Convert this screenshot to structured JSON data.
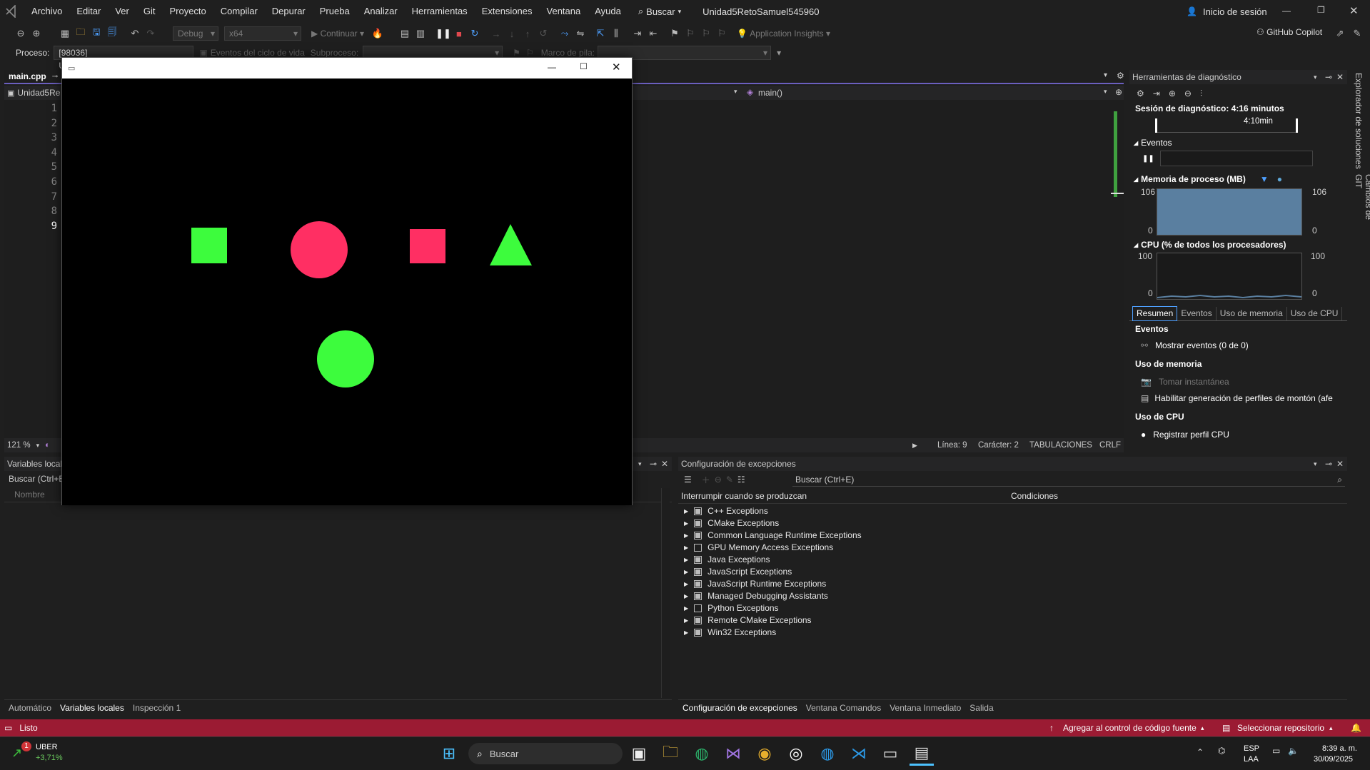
{
  "menubar": {
    "items": [
      "Archivo",
      "Editar",
      "Ver",
      "Git",
      "Proyecto",
      "Compilar",
      "Depurar",
      "Prueba",
      "Analizar",
      "Herramientas",
      "Extensiones",
      "Ventana",
      "Ayuda"
    ],
    "search": "Buscar",
    "solution": "Unidad5RetoSamuel545960",
    "signin": "Inicio de sesión"
  },
  "toolbar": {
    "config": "Debug",
    "platform": "x64",
    "continue": "Continuar",
    "app_insights": "Application Insights",
    "copilot": "GitHub Copilot"
  },
  "procbar": {
    "label": "Proceso:",
    "process": "[98036] Unidad5RetoSamuel54596(",
    "lifecycle": "Eventos del ciclo de vida",
    "thread_label": "Subproceso:",
    "stack_label": "Marco de pila:"
  },
  "editor": {
    "tab": "main.cpp",
    "project": "Unidad5Re",
    "function": "main()",
    "lines": [
      "1",
      "2",
      "3",
      "4",
      "5",
      "6",
      "7",
      "8",
      "9"
    ],
    "zoom": "121 %",
    "line": "Línea: 9",
    "col": "Carácter: 2",
    "tabs_mode": "TABULACIONES",
    "eol": "CRLF"
  },
  "app_window": {
    "shapes": [
      {
        "type": "square",
        "color": "#3dfc3d"
      },
      {
        "type": "circle",
        "color": "#ff2f63"
      },
      {
        "type": "square",
        "color": "#ff2f63"
      },
      {
        "type": "triangle",
        "color": "#3dfc3d"
      },
      {
        "type": "circle",
        "color": "#3dfc3d"
      }
    ]
  },
  "diag": {
    "title": "Herramientas de diagnóstico",
    "session": "Sesión de diagnóstico: 4:16 minutos",
    "timeline_label": "4:10min",
    "events": "Eventos",
    "memory": "Memoria de proceso (MB)",
    "mem_max": "106",
    "mem_min": "0",
    "cpu": "CPU (% de todos los procesadores)",
    "cpu_max": "100",
    "cpu_min": "0",
    "tabs": [
      "Resumen",
      "Eventos",
      "Uso de memoria",
      "Uso de CPU"
    ],
    "sum_events": "Eventos",
    "show_events": "Mostrar eventos (0 de 0)",
    "mem_use": "Uso de memoria",
    "snapshot": "Tomar instantánea",
    "heap": "Habilitar generación de perfiles de montón (afe",
    "cpu_use": "Uso de CPU",
    "cpu_profile": "Registrar perfil CPU"
  },
  "vtabs": [
    "Explorador de soluciones",
    "Cambios de GIT"
  ],
  "locals": {
    "title": "Variables locales",
    "search": "Buscar (Ctrl+E)",
    "col_name": "Nombre",
    "tabs": [
      "Automático",
      "Variables locales",
      "Inspección 1"
    ]
  },
  "exceptions": {
    "title": "Configuración de excepciones",
    "search": "Buscar (Ctrl+E)",
    "col_break": "Interrumpir cuando se produzcan",
    "col_cond": "Condiciones",
    "items": [
      {
        "label": "C++ Exceptions",
        "on": true
      },
      {
        "label": "CMake Exceptions",
        "on": true
      },
      {
        "label": "Common Language Runtime Exceptions",
        "on": true
      },
      {
        "label": "GPU Memory Access Exceptions",
        "on": false
      },
      {
        "label": "Java Exceptions",
        "on": true
      },
      {
        "label": "JavaScript Exceptions",
        "on": true
      },
      {
        "label": "JavaScript Runtime Exceptions",
        "on": true
      },
      {
        "label": "Managed Debugging Assistants",
        "on": true
      },
      {
        "label": "Python Exceptions",
        "on": false
      },
      {
        "label": "Remote CMake Exceptions",
        "on": true
      },
      {
        "label": "Win32 Exceptions",
        "on": true
      }
    ],
    "tabs": [
      "Configuración de excepciones",
      "Ventana Comandos",
      "Ventana Inmediato",
      "Salida"
    ]
  },
  "status": {
    "ready": "Listo",
    "source": "Agregar al control de código fuente",
    "repo": "Seleccionar repositorio"
  },
  "taskbar": {
    "stock": "UBER",
    "change": "+3,71%",
    "badge": "1",
    "search": "Buscar",
    "lang1": "ESP",
    "lang2": "LAA",
    "time": "8:39 a. m.",
    "date": "30/09/2025"
  },
  "colors": {
    "accent": "#6b5fbf",
    "status": "#9b1b33",
    "green": "#3dfc3d",
    "pink": "#ff2f63"
  }
}
